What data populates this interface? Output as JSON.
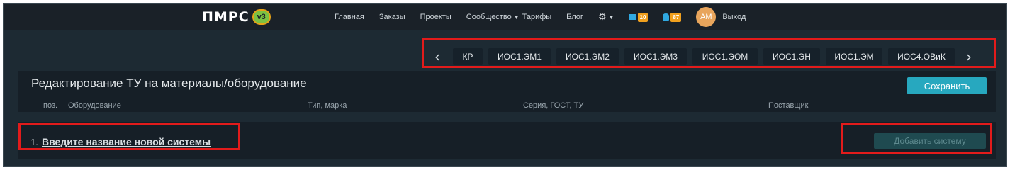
{
  "logo": {
    "text": "ПМРС",
    "version": "v3"
  },
  "nav": {
    "items": [
      "Главная",
      "Заказы",
      "Проекты",
      "Сообщество",
      "Тарифы",
      "Блог"
    ],
    "messages_count": "10",
    "notifications_count": "87",
    "avatar_initials": "AM",
    "logout": "Выход"
  },
  "tabs": [
    "КР",
    "ИОС1.ЭМ1",
    "ИОС1.ЭМ2",
    "ИОС1.ЭМ3",
    "ИОС1.ЭОМ",
    "ИОС1.ЭН",
    "ИОС1.ЭМ",
    "ИОС4.ОВиК"
  ],
  "editor": {
    "title": "Редактирование ТУ на материалы/оборудование",
    "save_label": "Сохранить",
    "columns": [
      "поз.",
      "Оборудование",
      "Тип, марка",
      "Серия, ГОСТ, ТУ",
      "Поставщик"
    ]
  },
  "system": {
    "number": "1.",
    "name": "Введите название новой системы",
    "add_label": "Добавить систему"
  },
  "colors": {
    "accent": "#27a8bf",
    "highlight": "#e21b1b",
    "badge": "#f0a01e"
  }
}
